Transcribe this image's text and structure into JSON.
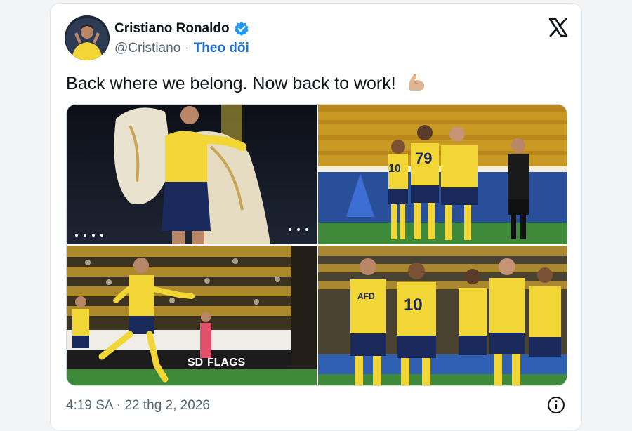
{
  "header": {
    "display_name": "Cristiano Ronaldo",
    "handle": "@Cristiano",
    "separator": "·",
    "follow_label": "Theo dõi",
    "verified_icon": "verified-badge-icon",
    "platform_icon": "x-logo-icon"
  },
  "tweet": {
    "text": "Back where we belong. Now back to work!",
    "emoji": "flexed-biceps-emoji"
  },
  "media": {
    "photos": [
      {
        "jersey": "",
        "banner": ""
      },
      {
        "jersey": "79",
        "banner": ""
      },
      {
        "jersey": "",
        "banner": "FLAGS"
      },
      {
        "jersey": "10",
        "banner": ""
      }
    ],
    "photo3_banner_prefix": "SD",
    "photo4_sponsor": "AFD",
    "photo2_jersey_small": "10"
  },
  "footer": {
    "timestamp": "4:19 SA · 22 thg 2, 2026",
    "info_icon": "info-icon"
  },
  "colors": {
    "accent": "#1d6fd1",
    "verified": "#1d9bf0",
    "jersey_yellow": "#f2d635",
    "shorts_navy": "#1b2a5c",
    "pitch_green": "#3f8a3a"
  }
}
